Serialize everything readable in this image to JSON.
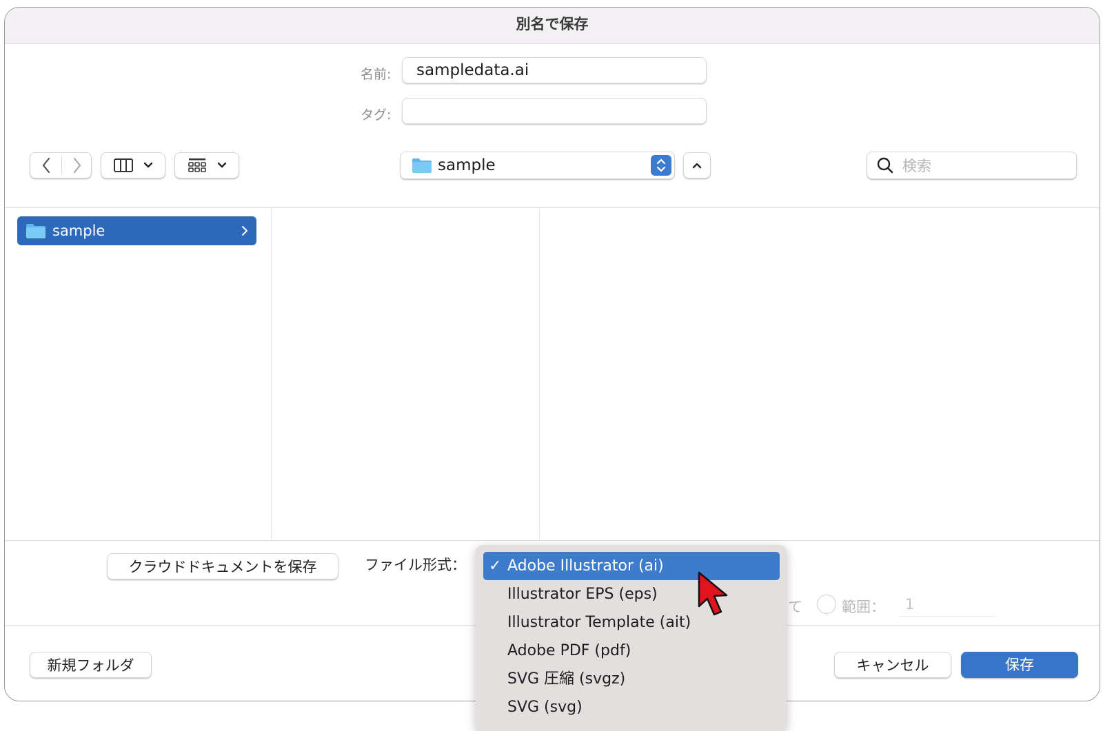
{
  "dialog": {
    "title": "別名で保存"
  },
  "form": {
    "name_label": "名前:",
    "name_value": "sampledata.ai",
    "tags_label": "タグ:",
    "tags_value": ""
  },
  "toolbar": {
    "location": "sample",
    "search_placeholder": "検索"
  },
  "browser": {
    "columns": [
      {
        "items": [
          {
            "label": "sample",
            "selected": true
          }
        ]
      }
    ]
  },
  "options": {
    "cloud_button": "クラウドドキュメントを保存",
    "format_label": "ファイル形式：",
    "format_selected": "Adobe Illustrator (ai)",
    "format_options": [
      "Adobe Illustrator (ai)",
      "Illustrator EPS (eps)",
      "Illustrator Template (ait)",
      "Adobe PDF (pdf)",
      "SVG 圧縮 (svgz)",
      "SVG (svg)"
    ],
    "artboard_partial": "て",
    "range_label": "範囲：",
    "range_value": "1"
  },
  "footer": {
    "new_folder": "新規フォルダ",
    "cancel": "キャンセル",
    "save": "保存"
  },
  "colors": {
    "accent": "#2e68b9",
    "menu_bg": "#e3dfdf",
    "cursor": "#e0141e"
  }
}
